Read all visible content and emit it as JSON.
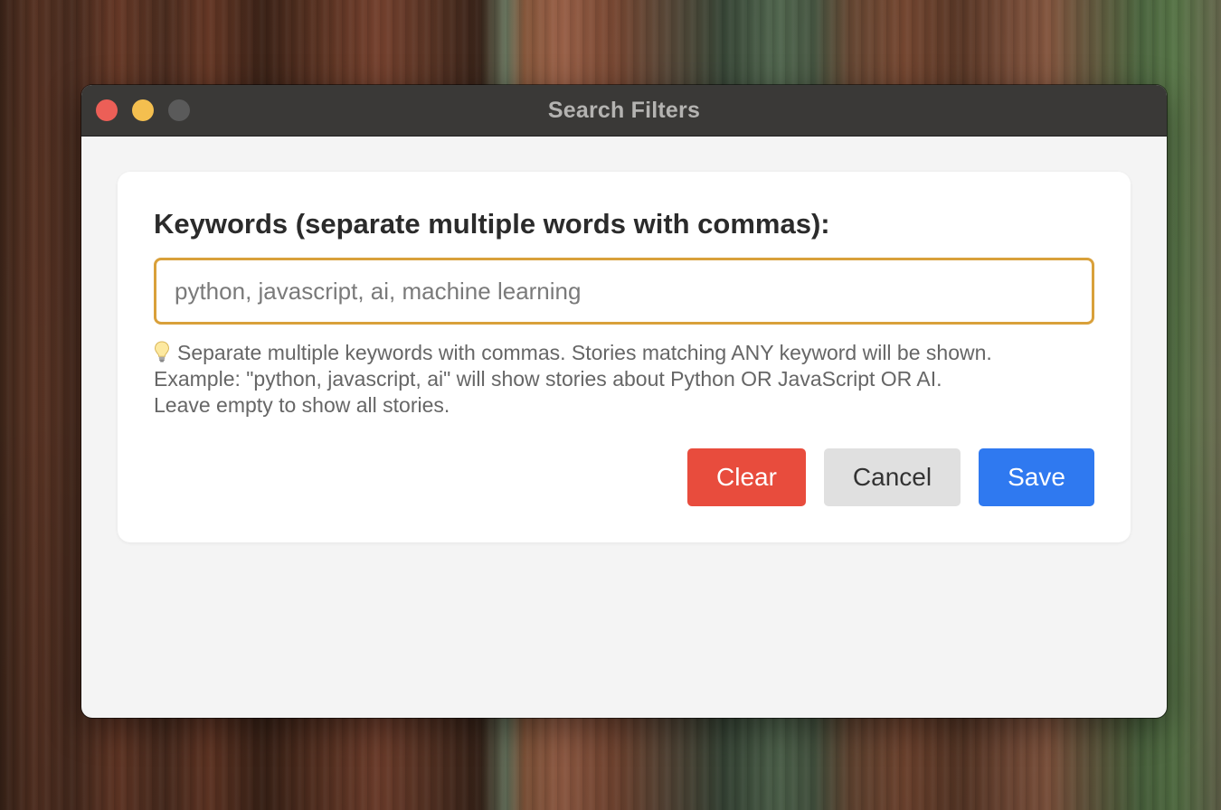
{
  "window": {
    "title": "Search Filters"
  },
  "form": {
    "label": "Keywords (separate multiple words with commas):",
    "input_value": "",
    "input_placeholder": "python, javascript, ai, machine learning",
    "help_icon": "lightbulb-icon",
    "help_line_1": "Separate multiple keywords with commas. Stories matching ANY keyword will be shown.",
    "help_line_2": "Example: \"python, javascript, ai\" will show stories about Python OR JavaScript OR AI.",
    "help_line_3": "Leave empty to show all stories."
  },
  "buttons": {
    "clear_label": "Clear",
    "cancel_label": "Cancel",
    "save_label": "Save"
  },
  "colors": {
    "input_focus_border": "#d9a03a",
    "clear_button": "#e84c3d",
    "cancel_button": "#e0e0e0",
    "save_button": "#2f79f0"
  }
}
